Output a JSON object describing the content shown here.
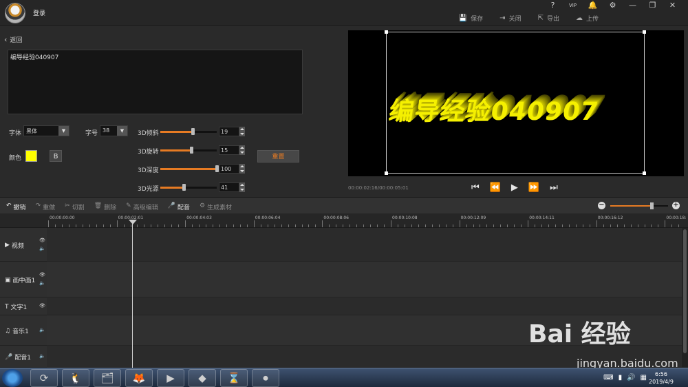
{
  "titlebar": {
    "login": "登录",
    "window_icons": [
      "?",
      "VIP",
      "🔔",
      "⚙",
      "—",
      "❐",
      "✕"
    ],
    "actions": [
      {
        "icon": "save-icon",
        "glyph": "💾",
        "label": "保存"
      },
      {
        "icon": "close-doc-icon",
        "glyph": "⇥",
        "label": "关闭"
      },
      {
        "icon": "export-icon",
        "glyph": "⇱",
        "label": "导出"
      },
      {
        "icon": "upload-icon",
        "glyph": "☁",
        "label": "上传"
      }
    ]
  },
  "editor": {
    "back": "返回",
    "text_value": "编导经验040907",
    "font_label": "字体",
    "font_value": "黑体",
    "size_label": "字号",
    "size_value": "38",
    "color_label": "颜色",
    "color_value": "#ffff00",
    "bold_label": "B",
    "reset_label": "重置",
    "sliders": [
      {
        "label": "3D倾斜",
        "value": "19",
        "fill": 0.57
      },
      {
        "label": "3D旋转",
        "value": "15",
        "fill": 0.55
      },
      {
        "label": "3D深度",
        "value": "100",
        "fill": 1.0
      },
      {
        "label": "3D光源",
        "value": "41",
        "fill": 0.42
      }
    ]
  },
  "preview": {
    "title_text": "编导经验040907",
    "timecode": "00:00:02:16/00:00:05:01",
    "controls": [
      "⏮",
      "⏪",
      "▶",
      "⏩",
      "⏭"
    ]
  },
  "timeline": {
    "tools": [
      {
        "icon": "undo-icon",
        "glyph": "↶",
        "label": "撤销",
        "active": true
      },
      {
        "icon": "redo-icon",
        "glyph": "↷",
        "label": "重做",
        "active": false
      },
      {
        "icon": "cut-icon",
        "glyph": "✂",
        "label": "切割",
        "active": false
      },
      {
        "icon": "delete-icon",
        "glyph": "🗑",
        "label": "删除",
        "active": false
      },
      {
        "icon": "advanced-edit-icon",
        "glyph": "✎",
        "label": "高级编辑",
        "active": false
      },
      {
        "icon": "voiceover-icon",
        "glyph": "🎤",
        "label": "配音",
        "active": true
      },
      {
        "icon": "generate-icon",
        "glyph": "⚙",
        "label": "生成素材",
        "active": false
      }
    ],
    "zoom_minus": "−",
    "zoom_plus": "+",
    "zoom_level": 0.72,
    "ruler": [
      "00:00:00:00",
      "00:00:02:01",
      "00:00:04:03",
      "00:00:06:04",
      "00:00:08:06",
      "00:00:10:08",
      "00:00:12:09",
      "00:00:14:11",
      "00:00:16:12",
      "00:00:18:"
    ],
    "tracks": [
      {
        "icon": "video-icon",
        "glyph": "▶",
        "label": "视频",
        "eye": true,
        "sound": true
      },
      {
        "icon": "pip-icon",
        "glyph": "▣",
        "label": "画中画1",
        "eye": true,
        "sound": true
      },
      {
        "icon": "text-icon",
        "glyph": "T",
        "label": "文字1",
        "eye": true,
        "sound": false
      },
      {
        "icon": "music-icon",
        "glyph": "♫",
        "label": "音乐1",
        "eye": false,
        "sound": true
      },
      {
        "icon": "mic-icon",
        "glyph": "🎤",
        "label": "配音1",
        "eye": false,
        "sound": true
      }
    ]
  },
  "watermark": {
    "brand": "Bai 经验",
    "url": "jingyan.baidu.com"
  },
  "taskbar": {
    "apps": [
      "⟳",
      "🐧",
      "🗂",
      "🦊",
      "▶",
      "◆",
      "⌛",
      "⏺"
    ],
    "clock_time": "6:56",
    "clock_date": "2019/4/9"
  }
}
